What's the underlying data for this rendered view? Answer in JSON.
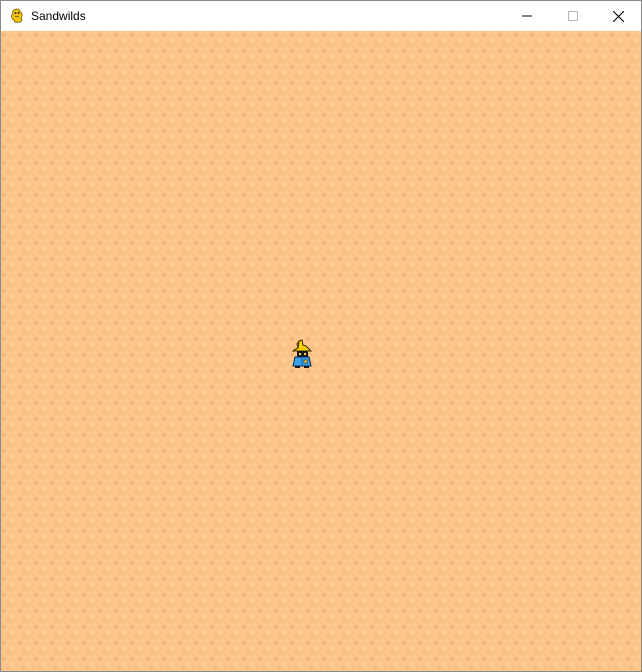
{
  "window": {
    "title": "Sandwilds",
    "app_icon": "pygame-snake-icon",
    "controls": [
      "minimize-icon",
      "maximize-icon",
      "close-icon"
    ]
  },
  "game": {
    "terrain": "sand",
    "player": {
      "sprite": "black-mage-sprite",
      "hat_color": "#f5d000",
      "robe_color": "#3aa0e8",
      "face_color": "#1a1a1a"
    },
    "colors": {
      "sand_base": "#fdc58a",
      "sand_dark": "#ecaa68",
      "sand_light": "#ffd6a0"
    }
  }
}
